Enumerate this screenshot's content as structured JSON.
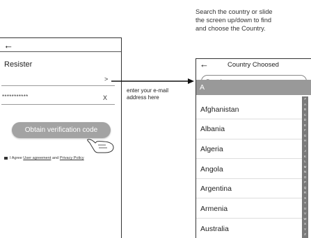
{
  "annotations": {
    "search_hint_lines": [
      "Search the country or slide",
      "the screen up/down to find",
      "and choose the Country."
    ],
    "email_hint_lines": [
      "enter your e-mail",
      "address here"
    ]
  },
  "register": {
    "back_icon": "arrow-left-icon",
    "title": "Resister",
    "account_chevron": ">",
    "password_mask": "***********",
    "clear_icon": "X",
    "verify_button": "Obtain verification code",
    "agree_prefix": "I Agree",
    "user_agreement": "User agreement",
    "and_text": "and",
    "privacy_policy": "Privacy Policy"
  },
  "country": {
    "back_icon": "arrow-left-icon",
    "title": "Country Choosed",
    "search_placeholder": "Search",
    "section_letter": "A",
    "countries": [
      "Afghanistan",
      "Albania",
      "Algeria",
      "Angola",
      "Argentina",
      "Armenia",
      "Australia"
    ],
    "index_letters": [
      "#",
      "A",
      "B",
      "C",
      "D",
      "E",
      "F",
      "G",
      "H",
      "I",
      "J",
      "K",
      "L",
      "M",
      "N",
      "O",
      "P",
      "Q",
      "R",
      "S",
      "T",
      "U",
      "V",
      "W",
      "X",
      "Y",
      "Z"
    ]
  }
}
